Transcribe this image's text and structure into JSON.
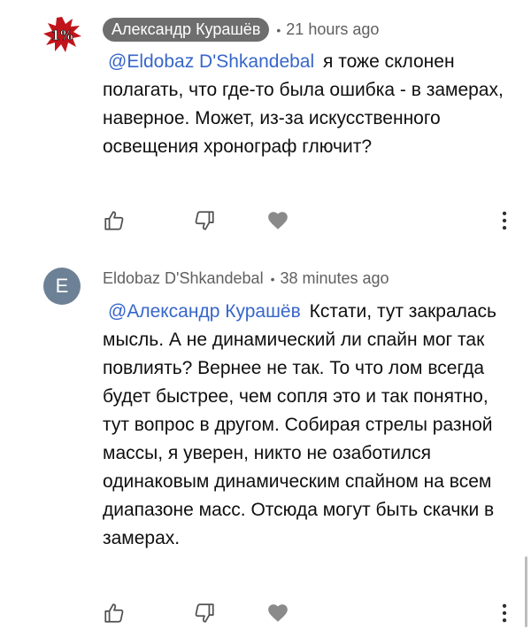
{
  "comments": [
    {
      "author": "Александр Курашёв",
      "time": "21 hours ago",
      "avatar_text": "1%",
      "mention": "@Eldobaz D'Shkandebal",
      "text": "я тоже склонен полагать, что где-то была ошибка - в замерах, наверное. Может, из-за искусственного освещения хронограф глючит?"
    },
    {
      "author": "Eldobaz D'Shkandebal",
      "time": "38 minutes ago",
      "avatar_letter": "E",
      "mention": "@Александр Курашёв",
      "text": "Кстати, тут закралась мысль. А не динамический ли спайн мог так повлиять? Вернее не так. То что лом всегда будет быстрее, чем сопля это и так понятно, тут вопрос в другом. Собирая стрелы разной массы, я уверен, никто не озаботился одинаковым динамическим спайном на всем диапазоне масс. Отсюда могут быть скачки в замерах."
    }
  ],
  "separator": "•",
  "colors": {
    "mention": "#3766c9",
    "author_chip": "#6e6e6e",
    "avatar_letter_bg": "#6c8196",
    "logo_red": "#c0151b",
    "icon": "#505050"
  }
}
